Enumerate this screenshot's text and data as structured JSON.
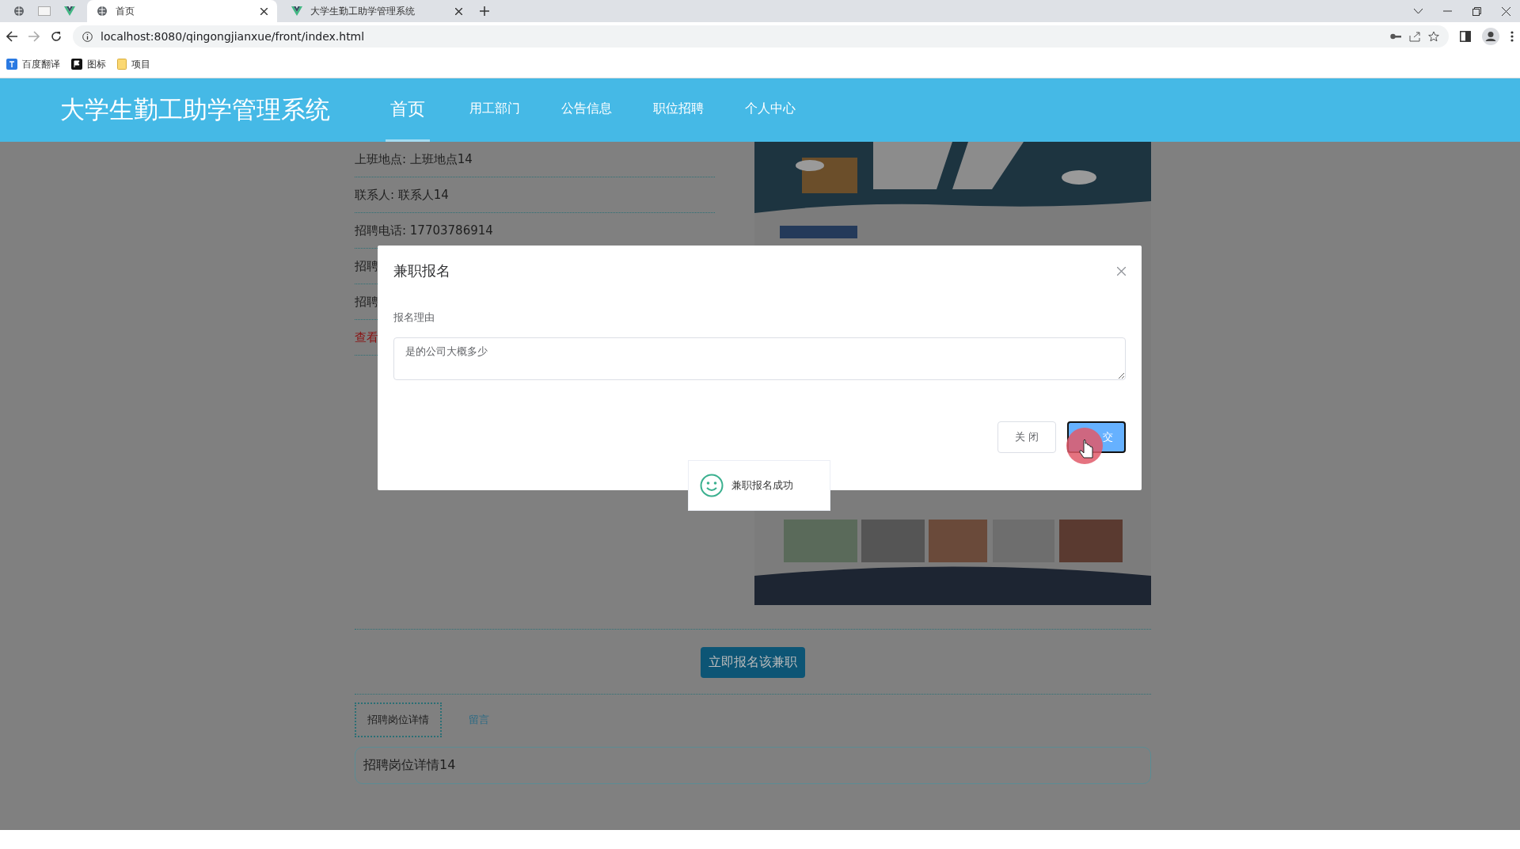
{
  "browser": {
    "tabs": [
      {
        "title": "首页",
        "selected": true
      },
      {
        "title": "大学生勤工助学管理系统",
        "selected": false
      }
    ],
    "url": "localhost:8080/qingongjianxue/front/index.html",
    "bookmarks": [
      "百度翻译",
      "图标",
      "项目"
    ]
  },
  "header": {
    "title": "大学生勤工助学管理系统",
    "nav": [
      {
        "label": "首页",
        "selected": true
      },
      {
        "label": "用工部门",
        "selected": false
      },
      {
        "label": "公告信息",
        "selected": false
      },
      {
        "label": "职位招聘",
        "selected": false
      },
      {
        "label": "个人中心",
        "selected": false
      }
    ]
  },
  "details": [
    {
      "text": "上班地点: 上班地点14",
      "kind": "plain"
    },
    {
      "text": "联系人: 联系人14",
      "kind": "plain"
    },
    {
      "text": "招聘电话: 17703786914",
      "kind": "plain"
    },
    {
      "text": "招聘",
      "kind": "plain"
    },
    {
      "text": "招聘",
      "kind": "plain"
    },
    {
      "text": "查看",
      "kind": "link"
    }
  ],
  "apply_button": "立即报名该兼职",
  "tabs": [
    {
      "label": "招聘岗位详情",
      "selected": true
    },
    {
      "label": "留言",
      "selected": false
    }
  ],
  "tab_content": "招聘岗位详情14",
  "dialog": {
    "title": "兼职报名",
    "field_label": "报名理由",
    "reason": "是的公司大概多少",
    "buttons": [
      {
        "label": "关 闭",
        "kind": "default"
      },
      {
        "label": "交",
        "kind": "primary"
      }
    ]
  },
  "toast": {
    "message": "兼职报名成功"
  }
}
